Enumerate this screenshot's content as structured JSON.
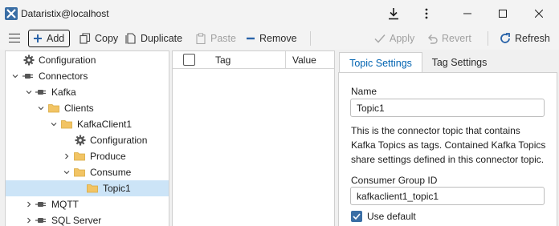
{
  "window": {
    "title": "Dataristix@localhost"
  },
  "toolbar": {
    "add": "Add",
    "copy": "Copy",
    "duplicate": "Duplicate",
    "paste": "Paste",
    "remove": "Remove",
    "apply": "Apply",
    "revert": "Revert",
    "refresh": "Refresh"
  },
  "tree": {
    "items": [
      {
        "label": "Configuration",
        "icon": "gear-icon"
      },
      {
        "label": "Connectors",
        "icon": "plug-icon"
      },
      {
        "label": "Kafka",
        "icon": "plug-icon"
      },
      {
        "label": "Clients",
        "icon": "folder-icon"
      },
      {
        "label": "KafkaClient1",
        "icon": "folder-icon"
      },
      {
        "label": "Configuration",
        "icon": "gear-icon"
      },
      {
        "label": "Produce",
        "icon": "folder-icon"
      },
      {
        "label": "Consume",
        "icon": "folder-icon"
      },
      {
        "label": "Topic1",
        "icon": "folder-icon",
        "selected": true
      },
      {
        "label": "MQTT",
        "icon": "plug-icon"
      },
      {
        "label": "SQL Server",
        "icon": "plug-icon"
      }
    ]
  },
  "tag_table": {
    "columns": [
      "Tag",
      "Value"
    ]
  },
  "panel": {
    "tabs": [
      "Topic Settings",
      "Tag Settings"
    ],
    "name_label": "Name",
    "name_value": "Topic1",
    "description": [
      "This is the connector topic that contains",
      "Kafka Topics as tags. Contained Kafka Topics",
      "share settings defined in this connector topic."
    ],
    "consumer_group_label": "Consumer Group ID",
    "consumer_group_value": "kafkaclient1_topic1",
    "use_default_label": "Use default",
    "use_default_checked": true
  },
  "colors": {
    "accent": "#0063b1",
    "selected_row": "#cce4f7",
    "folder": "#f2c464"
  }
}
